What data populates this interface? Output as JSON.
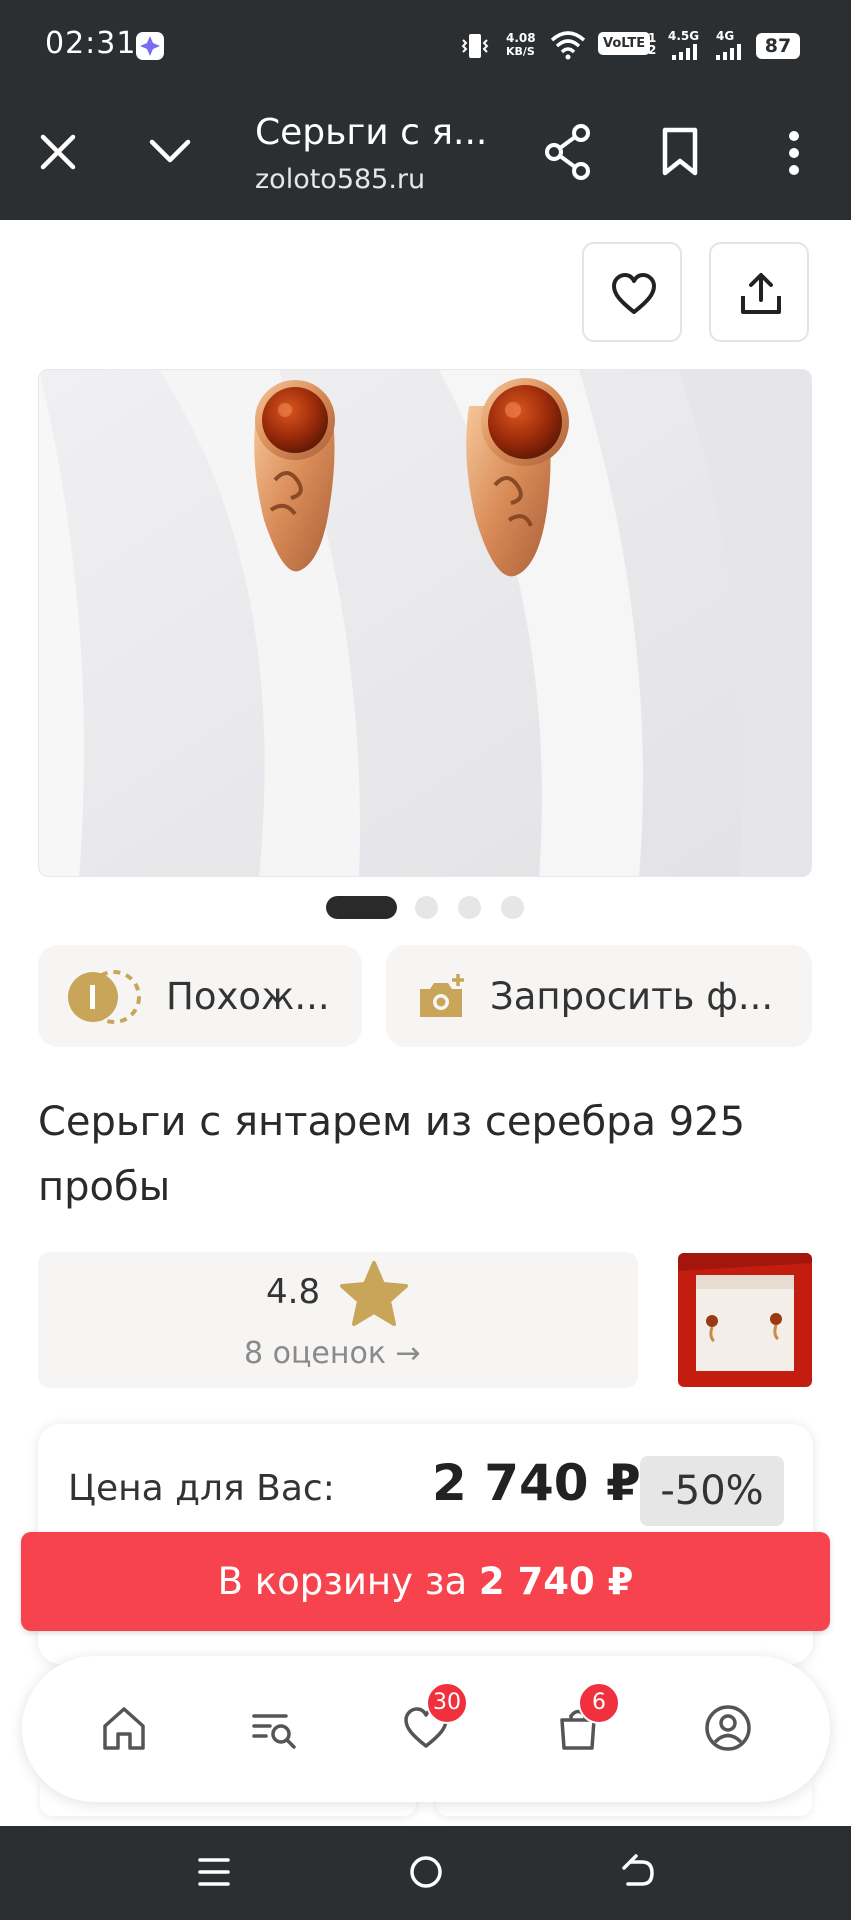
{
  "status_bar": {
    "time": "02:31",
    "net_speed_value": "4.08",
    "net_speed_unit": "KB/S",
    "volte": "VoLTE",
    "sim1_tech": "4.5G",
    "sim2_tech": "4G",
    "battery": "87"
  },
  "browser": {
    "title": "Серьги с я...",
    "url": "zoloto585.ru"
  },
  "gallery": {
    "page_count": 4,
    "active_index": 0
  },
  "actions": {
    "similar_label": "Похож...",
    "request_photo_label": "Запросить ф..."
  },
  "product": {
    "title": "Серьги с янтарем из серебра 925 пробы"
  },
  "rating": {
    "score": "4.8",
    "count_label": "8 оценок →"
  },
  "price": {
    "label": "Цена для Вас:",
    "value": "2 740 ₽",
    "discount": "-50%"
  },
  "cart_cta": {
    "text": "В корзину за ",
    "price": "2 740 ₽"
  },
  "bottom_nav": {
    "favorites_badge": "30",
    "cart_badge": "6"
  },
  "colors": {
    "accent": "#f6434d",
    "gold": "#c9a55a",
    "dark_bar": "#2c2f31"
  }
}
